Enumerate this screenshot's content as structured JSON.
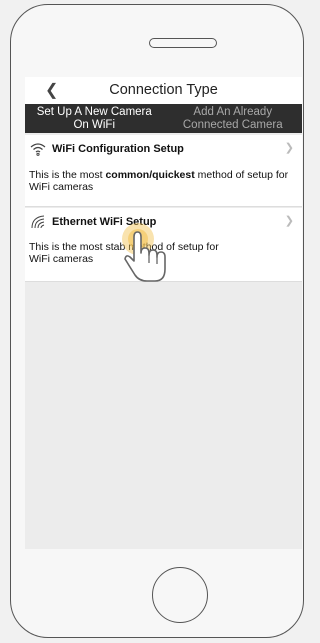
{
  "header": {
    "title": "Connection Type",
    "back_icon": "chevron-left-icon"
  },
  "tabs": [
    {
      "label": "Set Up A New Camera\nOn WiFi",
      "active": true
    },
    {
      "label": "Add An Already\nConnected Camera",
      "active": false
    }
  ],
  "options": [
    {
      "title": "WiFi Configuration Setup",
      "icon": "wifi-icon",
      "desc_prefix": "This is the most ",
      "desc_bold": "common/quickest",
      "desc_suffix": " method of setup for WiFi cameras"
    },
    {
      "title": "Ethernet WiFi Setup",
      "icon": "ethernet-signal-icon",
      "desc_prefix": "This is the most stab",
      "desc_suffix": "  method of setup for\nWiFi cameras"
    }
  ],
  "colors": {
    "tab_bar": "#2e2e2e",
    "pointer": "#f2c14e"
  }
}
